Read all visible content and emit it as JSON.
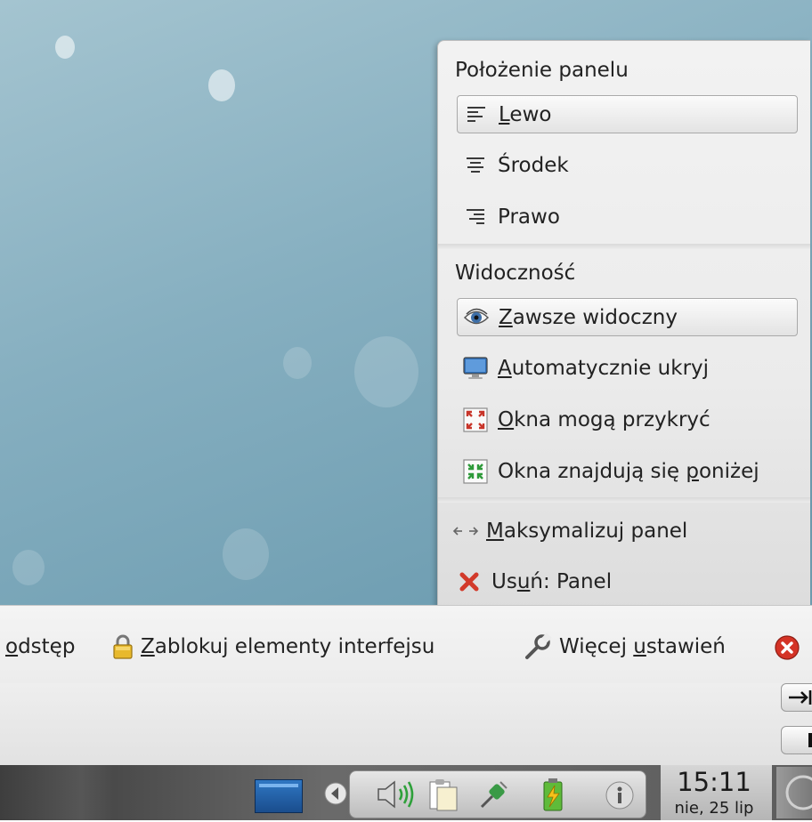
{
  "popup": {
    "position": {
      "title": "Położenie panelu",
      "options": [
        {
          "pre": "",
          "key": "L",
          "post": "ewo",
          "icon": "align-left-icon",
          "active": true
        },
        {
          "pre": "Środek",
          "key": "",
          "post": "",
          "icon": "align-center-icon",
          "active": false
        },
        {
          "pre": "Prawo",
          "key": "",
          "post": "",
          "icon": "align-right-icon",
          "active": false
        }
      ]
    },
    "visibility": {
      "title": "Widoczność",
      "options": [
        {
          "pre": "",
          "key": "Z",
          "post": "awsze widoczny",
          "icon": "eye-icon",
          "active": true
        },
        {
          "pre": "",
          "key": "A",
          "post": "utomatycznie ukryj",
          "icon": "monitor-icon",
          "active": false
        },
        {
          "pre": "",
          "key": "O",
          "post": "kna mogą przykryć",
          "icon": "windows-cover-icon",
          "active": false
        },
        {
          "pre": "Okna znajdują się ",
          "key": "p",
          "post": "oniżej",
          "icon": "windows-below-icon",
          "active": false
        }
      ]
    },
    "actions": [
      {
        "pre": "",
        "key": "M",
        "post": "aksymalizuj panel",
        "icon": "maximize-arrows-icon"
      },
      {
        "pre": "Us",
        "key": "u",
        "post": "ń: Panel",
        "icon": "remove-x-icon"
      }
    ]
  },
  "toolbar": {
    "spacer": {
      "pre": "",
      "key": "o",
      "post": "dstęp"
    },
    "lock": {
      "pre": "",
      "key": "Z",
      "post": "ablokuj elementy interfejsu",
      "icon": "lock-icon"
    },
    "more": {
      "pre": "Więcej ",
      "key": "u",
      "post": "stawień",
      "icon": "wrench-icon"
    },
    "close_icon": "close-circle-icon"
  },
  "taskbar": {
    "clock_time": "15:11",
    "clock_date": "nie, 25 lip",
    "tray_icons": [
      "volume-icon",
      "clipboard-icon",
      "usb-plug-icon",
      "battery-icon",
      "info-icon"
    ]
  },
  "colors": {
    "desktop": "#86afc0",
    "popup_bg": "#ececec",
    "remove_red": "#d23a2a"
  }
}
